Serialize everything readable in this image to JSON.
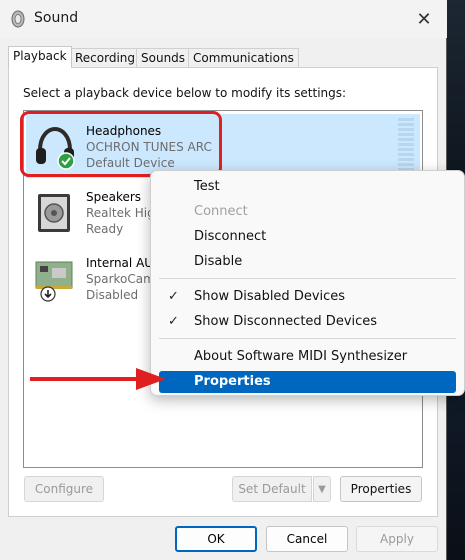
{
  "window": {
    "title": "Sound"
  },
  "tabs": [
    {
      "label": "Playback",
      "active": true
    },
    {
      "label": "Recording",
      "active": false
    },
    {
      "label": "Sounds",
      "active": false
    },
    {
      "label": "Communications",
      "active": false
    }
  ],
  "instruction": "Select a playback device below to modify its settings:",
  "devices": [
    {
      "name": "Headphones",
      "model": "OCHRON TUNES ARC",
      "status": "Default Device",
      "icon": "headphones-icon",
      "selected": true
    },
    {
      "name": "Speakers",
      "model": "Realtek Hig",
      "status": "Ready",
      "icon": "speaker-icon",
      "selected": false
    },
    {
      "name": "Internal AU",
      "model": "SparkoCam",
      "status": "Disabled",
      "icon": "sound-card-icon",
      "selected": false
    }
  ],
  "context_menu": {
    "items": [
      {
        "label": "Test",
        "disabled": false,
        "checked": false
      },
      {
        "label": "Connect",
        "disabled": true,
        "checked": false
      },
      {
        "label": "Disconnect",
        "disabled": false,
        "checked": false
      },
      {
        "label": "Disable",
        "disabled": false,
        "checked": false
      },
      {
        "label": "Show Disabled Devices",
        "disabled": false,
        "checked": true
      },
      {
        "label": "Show Disconnected Devices",
        "disabled": false,
        "checked": true
      },
      {
        "label": "About Software MIDI Synthesizer",
        "disabled": false,
        "checked": false
      },
      {
        "label": "Properties",
        "disabled": false,
        "checked": false,
        "highlighted": true
      }
    ]
  },
  "panel_buttons": {
    "configure": "Configure",
    "set_default": "Set Default",
    "properties": "Properties"
  },
  "dialog_buttons": {
    "ok": "OK",
    "cancel": "Cancel",
    "apply": "Apply"
  },
  "colors": {
    "accent": "#0067c0",
    "selection": "#cce8ff",
    "annotation_red": "#e02020"
  }
}
